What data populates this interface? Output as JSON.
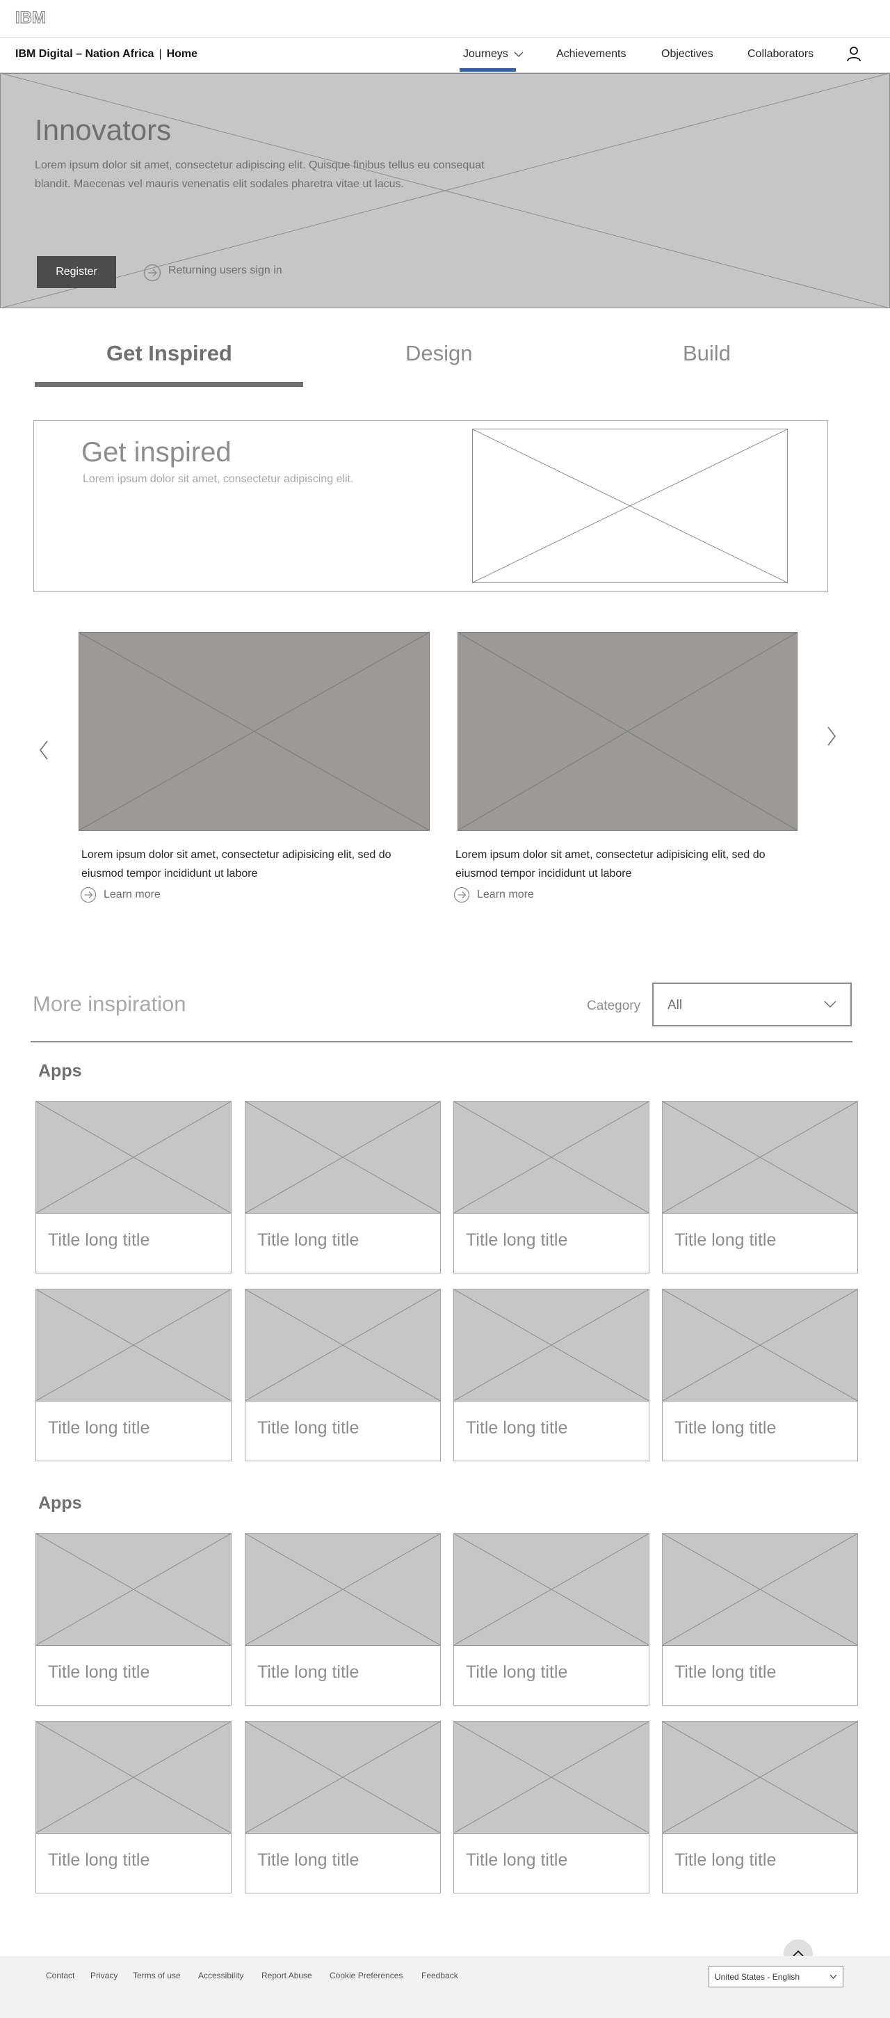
{
  "masthead": {
    "logo_text": "IBM"
  },
  "subnav": {
    "brand": "IBM Digital – Nation Africa",
    "brand_home": "Home",
    "items": [
      {
        "label": "Journeys",
        "active": true,
        "has_dropdown": true
      },
      {
        "label": "Achievements"
      },
      {
        "label": "Objectives"
      },
      {
        "label": "Collaborators"
      }
    ],
    "user_icon": "user-icon"
  },
  "hero": {
    "title": "Innovators",
    "description": "Lorem ipsum dolor sit amet, consectetur adipiscing elit. Quisque finibus tellus eu consequat blandit. Maecenas vel mauris venenatis elit sodales pharetra vitae ut lacus.",
    "register_label": "Register",
    "returning_label": "Returning users sign in"
  },
  "tabs": [
    {
      "label": "Get Inspired",
      "active": true
    },
    {
      "label": "Design"
    },
    {
      "label": "Build"
    }
  ],
  "get_inspired": {
    "title": "Get inspired",
    "subtitle": "Lorem ipsum dolor sit amet, consectetur adipiscing elit."
  },
  "carousel": {
    "items": [
      {
        "text": "Lorem ipsum dolor sit amet, consectetur adipisicing elit, sed do eiusmod tempor incididunt ut labore",
        "link": "Learn more"
      },
      {
        "text": "Lorem ipsum dolor sit amet, consectetur adipisicing elit, sed do eiusmod tempor incididunt ut labore",
        "link": "Learn more"
      }
    ],
    "prev_icon": "chevron-left-icon",
    "next_icon": "chevron-right-icon"
  },
  "more": {
    "title": "More inspiration",
    "category_label": "Category",
    "category_value": "All"
  },
  "sections": [
    {
      "heading": "Apps",
      "cards": [
        "Title long title",
        "Title long title",
        "Title long title",
        "Title long title",
        "Title long title",
        "Title long title",
        "Title long title",
        "Title long title"
      ]
    },
    {
      "heading": "Apps",
      "cards": [
        "Title long title",
        "Title long title",
        "Title long title",
        "Title long title",
        "Title long title",
        "Title long title",
        "Title long title",
        "Title long title"
      ]
    }
  ],
  "footer": {
    "links": [
      "Contact",
      "Privacy",
      "Terms of use",
      "Accessibility",
      "Report Abuse",
      "Cookie Preferences",
      "Feedback"
    ],
    "locale": "United States - English"
  },
  "colors": {
    "nav_active": "#2f5fa7",
    "placeholder_gray": "#c6c6c6",
    "carousel_gray": "#9b9a98",
    "button_dark": "#4c4c4c"
  }
}
